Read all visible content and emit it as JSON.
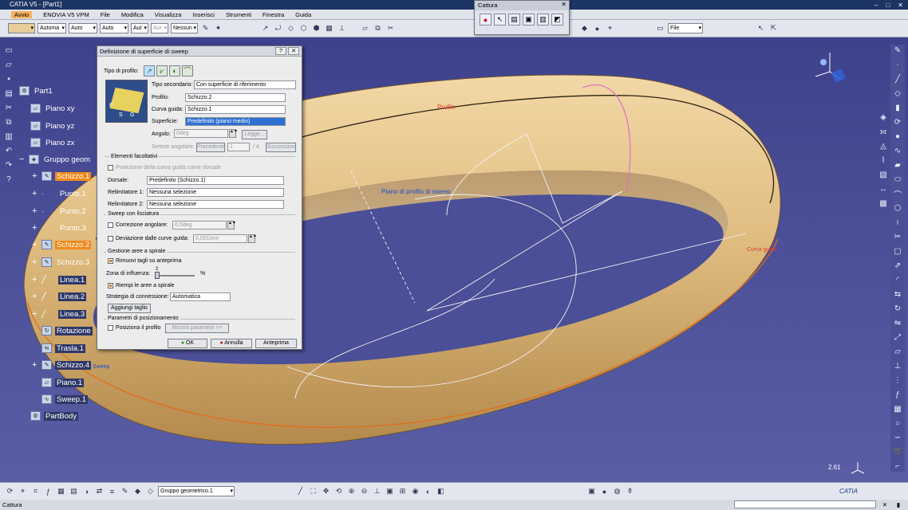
{
  "window": {
    "title": "CATIA V5 - [Part1]"
  },
  "menu": [
    "Avvio",
    "ENOVIA V5 VPM",
    "File",
    "Modifica",
    "Visualizza",
    "Inserisci",
    "Strumenti",
    "Finestra",
    "Guida"
  ],
  "toolbar": {
    "combos": [
      "Automa",
      "Auto",
      "Auto",
      "Aut",
      "Aut",
      "Nessun"
    ],
    "file_combo": "File"
  },
  "capture": {
    "title": "Cattura"
  },
  "tree": {
    "root": "Part1",
    "items": [
      "Piano xy",
      "Piano yz",
      "Piano zx",
      "Gruppo geom",
      "Schizzo.1",
      "Punto.1",
      "Punto.2",
      "Punto.3",
      "Schizzo.2",
      "Schizzo.3",
      "Linea.1",
      "Linea.2",
      "Linea.3",
      "Rotazione",
      "Trasla.1",
      "Schizzo.4",
      "Piano.1",
      "Sweep.1",
      "PartBody"
    ]
  },
  "dialog": {
    "title": "Definizione di superficie di sweep",
    "tipo_profilo_label": "Tipo di profilo:",
    "tipo_secondario_label": "Tipo secondario:",
    "tipo_secondario_value": "Con superficie di riferimento",
    "profilo_label": "Profilo:",
    "profilo_value": "Schizzo.2",
    "curva_guida_label": "Curva guida:",
    "curva_guida_value": "Schizzo.1",
    "superficie_label": "Superficie:",
    "superficie_value": "Predefinito (piano medio)",
    "angolo_label": "Angolo:",
    "angolo_value": "0deg",
    "legge_button": "Legge...",
    "settore_label": "Settore angolare:",
    "precedente_button": "Precedente",
    "settore_value": "1",
    "settore_total": "/ 4",
    "successivo_button": "Successivo",
    "elementi_facoltativi": "Elementi facoltativi",
    "proiezione_label": "Proiezione della curva guida come dorsale",
    "dorsale_label": "Dorsale:",
    "dorsale_value": "Predefinito (Schizzo.1)",
    "relimitatore1_label": "Relimitatore 1:",
    "relimitatore1_value": "Nessuna selezione",
    "relimitatore2_label": "Relimitatore 2:",
    "relimitatore2_value": "Nessuna selezione",
    "sweep_lisciatura": "Sweep con lisciatura",
    "correzione_label": "Correzione angolare:",
    "correzione_value": "0,5deg",
    "deviazione_label": "Deviazione dalle curve guida:",
    "deviazione_value": "0,001mm",
    "gestione_aree": "Gestione aree a spirale",
    "rimuovi_label": "Rimuovi tagli su anteprima",
    "zona_label": "Zona di influenza:",
    "zona_value": "2",
    "zona_unit": "%",
    "riempi_label": "Riempi le aree a spirale",
    "strategia_label": "Strategia di connessione:",
    "strategia_value": "Automatica",
    "aggiungi_button": "Aggiungi taglio",
    "parametri_posizionamento": "Parametri di posizionamento",
    "posiziona_label": "Posiziona il profilo",
    "mostra_button": "Mostra parametri >>",
    "ok_button": "OK",
    "annulla_button": "Annulla",
    "anteprima_button": "Anteprima",
    "preview_letters": [
      "P",
      "S",
      "G"
    ]
  },
  "viewport": {
    "label_profilo": "Profilo",
    "label_piano": "Piano di profilo di sweep",
    "label_sweep": "Sweep",
    "label_guida": "Curva guida",
    "scale": "2.61"
  },
  "bottom": {
    "combo": "Gruppo geometrico.1"
  },
  "status": {
    "text": "Cattura"
  },
  "colors": {
    "accent_orange": "#f08a1c",
    "ring": "#e2bf82",
    "background": "#4a4f97"
  }
}
